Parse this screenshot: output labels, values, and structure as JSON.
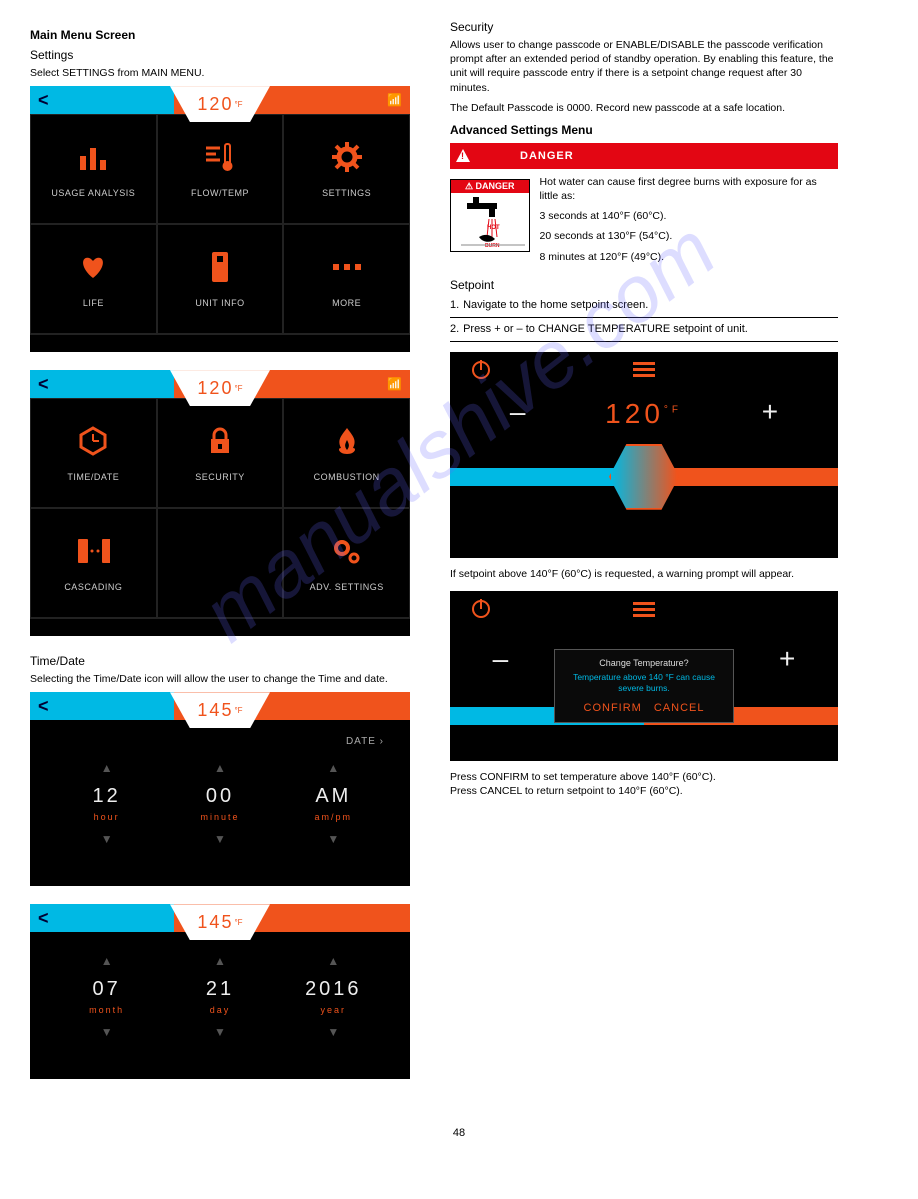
{
  "watermark": "manualshive.com",
  "page_number": "48",
  "left": {
    "section_title": "Main Menu Screen",
    "section_sub": "Settings",
    "section_desc": "Select SETTINGS from MAIN MENU.",
    "panel1": {
      "back": "<",
      "temp": "120",
      "unit": "°F",
      "items": [
        {
          "label": "USAGE ANALYSIS",
          "icon": "bars"
        },
        {
          "label": "FLOW/TEMP",
          "icon": "flowtemp"
        },
        {
          "label": "SETTINGS",
          "icon": "gear"
        },
        {
          "label": "LIFE",
          "icon": "heart"
        },
        {
          "label": "UNIT INFO",
          "icon": "unit"
        },
        {
          "label": "MORE",
          "icon": "dots"
        }
      ]
    },
    "panel2": {
      "back": "<",
      "temp": "120",
      "unit": "°F",
      "items": [
        {
          "label": "TIME/DATE",
          "icon": "clockhex"
        },
        {
          "label": "SECURITY",
          "icon": "lock"
        },
        {
          "label": "COMBUSTION",
          "icon": "flame"
        },
        {
          "label": "CASCADING",
          "icon": "cascade"
        },
        {
          "label": "",
          "icon": ""
        },
        {
          "label": "ADV. SETTINGS",
          "icon": "gears"
        }
      ]
    },
    "timedate_title": "Time/Date",
    "timedate_desc": "Selecting the Time/Date icon will allow the user to change the Time and date.",
    "time_panel": {
      "back": "<",
      "temp": "145",
      "unit": "°F",
      "link": "DATE ›",
      "cols": [
        {
          "val": "12",
          "lbl": "hour"
        },
        {
          "val": "00",
          "lbl": "minute"
        },
        {
          "val": "AM",
          "lbl": "am/pm"
        }
      ]
    },
    "date_panel": {
      "back": "<",
      "temp": "145",
      "unit": "°F",
      "cols": [
        {
          "val": "07",
          "lbl": "month"
        },
        {
          "val": "21",
          "lbl": "day"
        },
        {
          "val": "2016",
          "lbl": "year"
        }
      ]
    }
  },
  "right": {
    "security_title": "Security",
    "security_p1": "Allows user to change passcode or ENABLE/DISABLE the passcode verification prompt after an extended period of standby operation. By enabling this feature, the unit will require passcode entry if there is a setpoint change request after 30 minutes.",
    "security_p2": "The Default Passcode is 0000. Record new passcode at a safe location.",
    "adv_header": "Advanced Settings Menu",
    "danger_word": "DANGER",
    "danger_sign_top": "⚠ DANGER",
    "danger_p": "Hot water can cause first degree burns with exposure for as little as:",
    "exposure": [
      "3 seconds at 140°F (60°C).",
      "20 seconds at 130°F (54°C).",
      "8 minutes at 120°F (49°C)."
    ],
    "setpoint_h": "Setpoint",
    "instr": [
      {
        "n": "1.",
        "t": "Navigate to the home setpoint screen."
      },
      {
        "n": "2.",
        "t": "Press + or – to CHANGE TEMPERATURE setpoint of unit."
      }
    ],
    "rpanel1": {
      "temp": "120",
      "unit": "°F",
      "minus": "–",
      "plus": "+"
    },
    "note1": "If setpoint above 140°F (60°C) is requested, a warning prompt will appear.",
    "popup": {
      "q": "Change Temperature?",
      "w": "Temperature above 140 °F can cause severe burns.",
      "confirm": "CONFIRM",
      "cancel": "CANCEL"
    },
    "note2_a": "Press CONFIRM to set temperature above 140°F (60°C).",
    "note2_b": "Press CANCEL to return setpoint to 140°F (60°C)."
  }
}
